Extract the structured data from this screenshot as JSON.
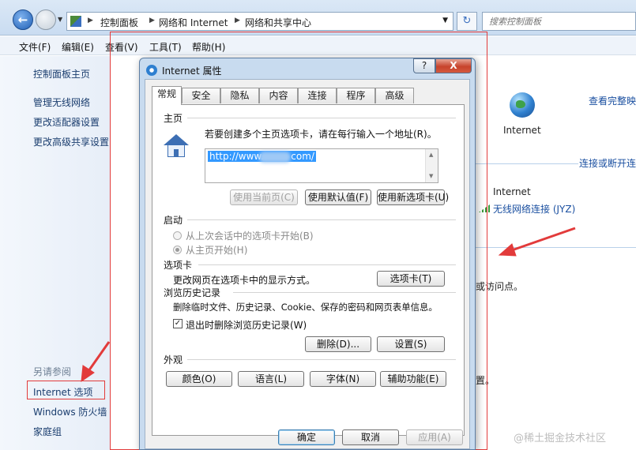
{
  "address_bar": {
    "breadcrumbs": [
      "控制面板",
      "网络和 Internet",
      "网络和共享中心"
    ],
    "search_placeholder": "搜索控制面板"
  },
  "menubar": [
    "文件(F)",
    "编辑(E)",
    "查看(V)",
    "工具(T)",
    "帮助(H)"
  ],
  "left_pane": {
    "items": [
      "控制面板主页",
      "管理无线网络",
      "更改适配器设置",
      "更改高级共享设置"
    ],
    "see_also_label": "另请参阅",
    "see_also": [
      "Internet 选项",
      "Windows 防火墙",
      "家庭组"
    ]
  },
  "right_content": {
    "view_full_map": "查看完整映",
    "internet_label": "Internet",
    "connect_disconnect": "连接或断开连",
    "internet_label2": "Internet",
    "wireless_connection": "无线网络连接 (JYZ)",
    "access_point_fragment": "或访问点。",
    "settings_fragment": "置。"
  },
  "dialog": {
    "title": "Internet 属性",
    "help_button": "?",
    "close_button": "X",
    "tabs": [
      "常规",
      "安全",
      "隐私",
      "内容",
      "连接",
      "程序",
      "高级"
    ],
    "homepage": {
      "section": "主页",
      "instruction": "若要创建多个主页选项卡，请在每行输入一个地址(R)。",
      "url": "http://www.",
      "url_tail": "com/",
      "btn_current": "使用当前页(C)",
      "btn_default": "使用默认值(F)",
      "btn_new_tab": "使用新选项卡(U)"
    },
    "startup": {
      "section": "启动",
      "option_last_session": "从上次会话中的选项卡开始(B)",
      "option_homepage": "从主页开始(H)"
    },
    "tabs_section": {
      "section": "选项卡",
      "description": "更改网页在选项卡中的显示方式。",
      "button": "选项卡(T)"
    },
    "history": {
      "section": "浏览历史记录",
      "description": "删除临时文件、历史记录、Cookie、保存的密码和网页表单信息。",
      "checkbox": "退出时删除浏览历史记录(W)",
      "checked": true,
      "btn_delete": "删除(D)...",
      "btn_settings": "设置(S)"
    },
    "appearance": {
      "section": "外观",
      "btn_colors": "颜色(O)",
      "btn_languages": "语言(L)",
      "btn_fonts": "字体(N)",
      "btn_accessibility": "辅助功能(E)"
    },
    "footer": {
      "ok": "确定",
      "cancel": "取消",
      "apply": "应用(A)"
    }
  },
  "watermark": "@稀土掘金技术社区",
  "colors": {
    "annotation": "#e23b3b",
    "link": "#1a4fa0"
  }
}
